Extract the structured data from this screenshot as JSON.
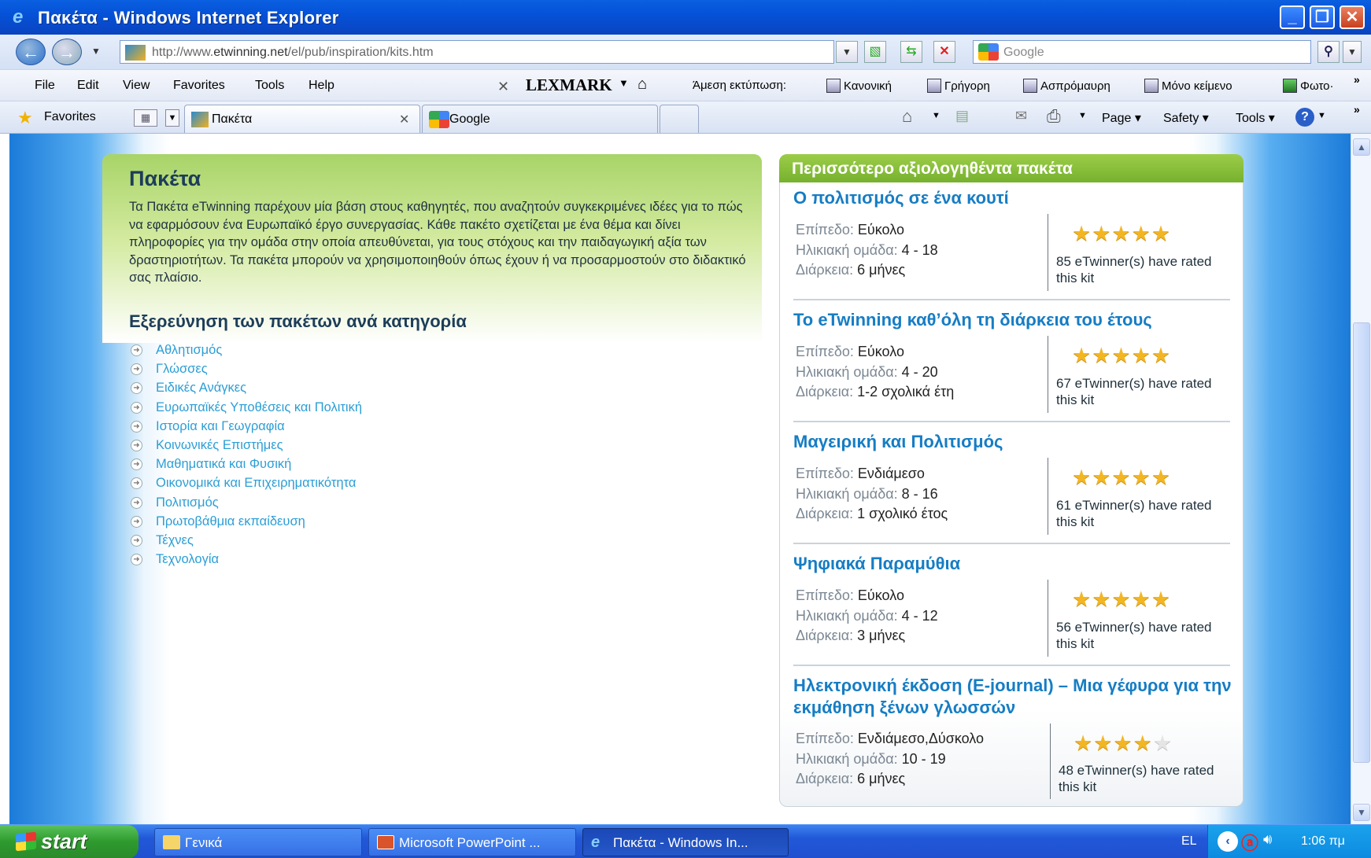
{
  "window": {
    "title": "Πακέτα - Windows Internet Explorer"
  },
  "address": {
    "url_prefix": "http://www.",
    "url_domain": "etwinning.net",
    "url_path": "/el/pub/inspiration/kits.htm",
    "search_placeholder": "Google"
  },
  "menu": {
    "items": [
      "File",
      "Edit",
      "View",
      "Favorites",
      "Tools",
      "Help"
    ]
  },
  "toolbar": {
    "lexmark": "LEXMARK",
    "print_label": "Άμεση εκτύπωση:",
    "buttons": [
      "Κανονική",
      "Γρήγορη",
      "Ασπρόμαυρη",
      "Μόνο κείμενο",
      "Φωτο·"
    ]
  },
  "favbar": {
    "favorites_label": "Favorites",
    "tab_active": "Πακέτα",
    "tab_second": "Google",
    "commands": [
      "Page",
      "Safety",
      "Tools"
    ]
  },
  "page": {
    "title": "Πακέτα",
    "intro": "Τα Πακέτα eTwinning παρέχουν μία βάση στους καθηγητές, που αναζητούν συγκεκριμένες ιδέες για το πώς να εφαρμόσουν ένα Ευρωπαϊκό έργο συνεργασίας. Κάθε πακέτο σχετίζεται με ένα θέμα και δίνει πληροφορίες για την ομάδα στην οποία απευθύνεται, για τους στόχους και την παιδαγωγική αξία των δραστηριοτήτων. Τα πακέτα μπορούν να χρησιμοποιηθούν όπως έχουν ή να προσαρμοστούν στο διδακτικό σας πλαίσιο.",
    "category_title": "Εξερεύνηση των πακέτων ανά κατηγορία",
    "categories": [
      "Αθλητισμός",
      "Γλώσσες",
      "Ειδικές Ανάγκες",
      "Ευρωπαϊκές Υποθέσεις και Πολιτική",
      "Ιστορία και Γεωγραφία",
      "Κοινωνικές Επιστήμες",
      "Μαθηματικά και Φυσική",
      "Οικονομικά και Επιχειρηματικότητα",
      "Πολιτισμός",
      "Πρωτοβάθμια εκπαίδευση",
      "Τέχνες",
      "Τεχνολογία"
    ]
  },
  "top_kits": {
    "heading": "Περισσότερο αξιολογηθέντα πακέτα",
    "labels": {
      "level": "Επίπεδο:",
      "age": "Ηλικιακή ομάδα:",
      "duration": "Διάρκεια:"
    },
    "kits": [
      {
        "title": "Ο πολιτισμός σε ένα κουτί",
        "level": "Εύκολο",
        "age": "4 - 18",
        "duration": "6 μήνες",
        "stars": 5,
        "rating": "85 eTwinner(s) have rated this kit"
      },
      {
        "title": "Το eTwinning καθ’όλη τη διάρκεια του έτους",
        "level": "Εύκολο",
        "age": "4 - 20",
        "duration": "1-2 σχολικά έτη",
        "stars": 5,
        "rating": "67 eTwinner(s) have rated this kit"
      },
      {
        "title": "Μαγειρική και Πολιτισμός",
        "level": "Ενδιάμεσο",
        "age": "8 - 16",
        "duration": "1 σχολικό έτος",
        "stars": 5,
        "rating": "61 eTwinner(s) have rated this kit"
      },
      {
        "title": "Ψηφιακά Παραμύθια",
        "level": "Εύκολο",
        "age": "4 - 12",
        "duration": "3 μήνες",
        "stars": 5,
        "rating": "56 eTwinner(s) have rated this kit"
      },
      {
        "title": "Ηλεκτρονική έκδοση (E-journal) – Μια γέφυρα για την εκμάθηση ξένων γλωσσών",
        "level": "Ενδιάμεσο,Δύσκολο",
        "age": "10 - 19",
        "duration": "6 μήνες",
        "stars": 4,
        "rating": "48 eTwinner(s) have rated this kit"
      }
    ]
  },
  "taskbar": {
    "start": "start",
    "tasks": [
      "Γενικά",
      "Microsoft PowerPoint ...",
      "Πακέτα - Windows In..."
    ],
    "lang": "EL",
    "clock": "1:06 πμ"
  }
}
